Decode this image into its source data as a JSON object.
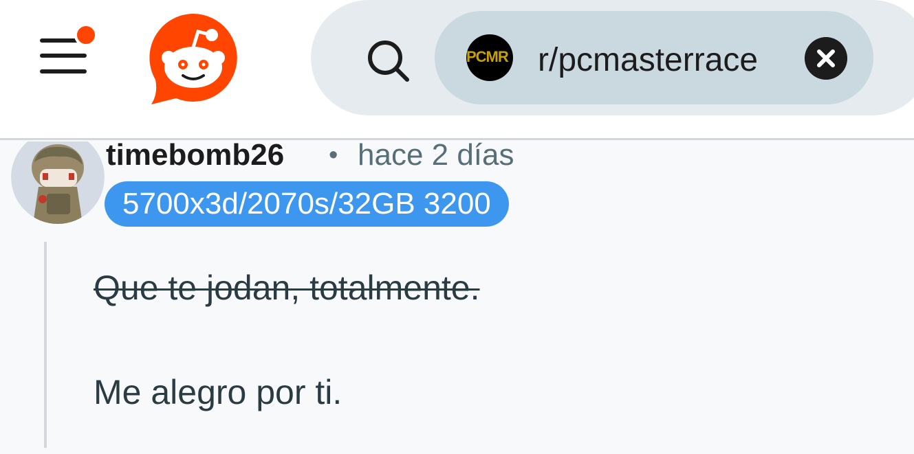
{
  "header": {
    "menu_icon": "hamburger-menu-icon",
    "logo_icon": "reddit-logo-icon",
    "search_icon": "search-icon",
    "clear_icon": "close-icon",
    "brand_color": "#ff4500",
    "search": {
      "community_avatar_text": "PCMR",
      "community": "r/pcmasterrace"
    }
  },
  "comment": {
    "author": "timebomb26",
    "separator": "•",
    "time": "hace 2 días",
    "flair": "5700x3d/2070s/32GB 3200",
    "flair_color": "#3d97ee",
    "struck_text": "Que te jodan, totalmente.",
    "body_text": "Me alegro por ti."
  }
}
